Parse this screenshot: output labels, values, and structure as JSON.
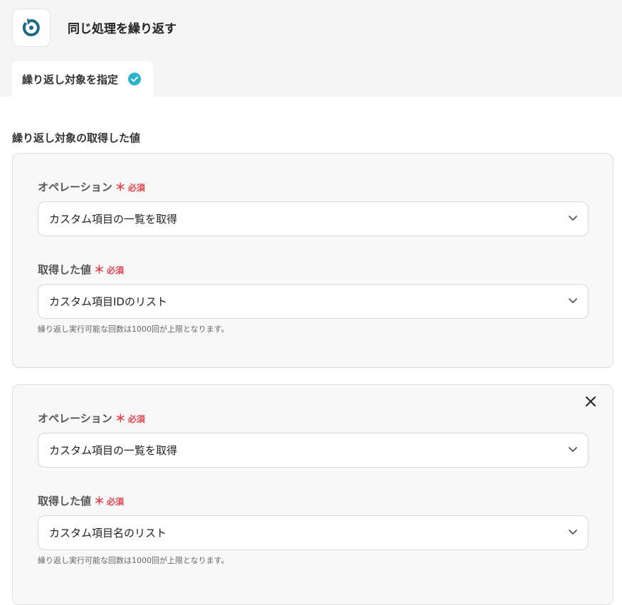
{
  "header": {
    "title": "同じ処理を繰り返す",
    "icon": "repeat-icon",
    "accent_color": "#1d6a86"
  },
  "tab": {
    "label": "繰り返し対象を指定",
    "status_icon": "check-circle-icon",
    "status_color": "#2bb3c8"
  },
  "section": {
    "title": "繰り返し対象の取得した値"
  },
  "cards": [
    {
      "operation_label": "オペレーション",
      "operation_required_mark": "＊",
      "operation_required_text": "必須",
      "operation_value": "カスタム項目の一覧を取得",
      "value_label": "取得した値",
      "value_required_mark": "＊",
      "value_required_text": "必須",
      "value_value": "カスタム項目IDのリスト",
      "hint": "繰り返し実行可能な回数は1000回が上限となります。"
    },
    {
      "operation_label": "オペレーション",
      "operation_required_mark": "＊",
      "operation_required_text": "必須",
      "operation_value": "カスタム項目の一覧を取得",
      "value_label": "取得した値",
      "value_required_mark": "＊",
      "value_required_text": "必須",
      "value_value": "カスタム項目名のリスト",
      "hint": "繰り返し実行可能な回数は1000回が上限となります。",
      "close_icon": "close-icon"
    }
  ]
}
